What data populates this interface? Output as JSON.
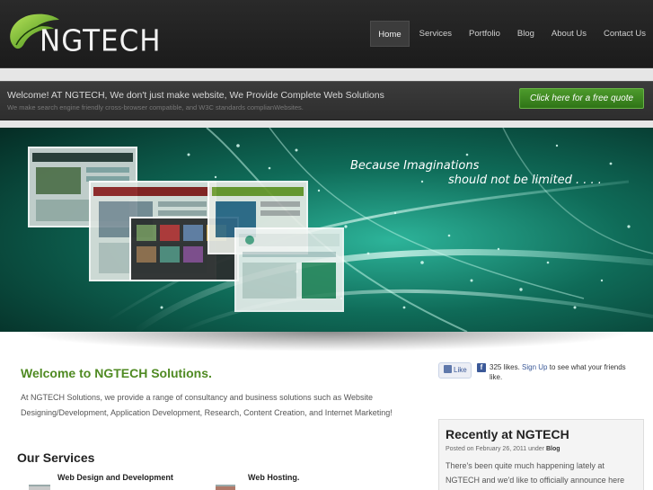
{
  "header": {
    "logo_text": "NGTECH",
    "nav": [
      {
        "label": "Home",
        "active": true
      },
      {
        "label": "Services",
        "active": false
      },
      {
        "label": "Portfolio",
        "active": false
      },
      {
        "label": "Blog",
        "active": false
      },
      {
        "label": "About Us",
        "active": false
      },
      {
        "label": "Contact Us",
        "active": false
      }
    ]
  },
  "welcome_bar": {
    "title": "Welcome! AT NGTECH, We don't just make website, We Provide Complete Web Solutions",
    "subtitle": "We make search engine friendly cross-browser compatible, and W3C standards complianWebsites.",
    "quote_button": "Click here for a free quote"
  },
  "hero": {
    "tagline_line1": "Because  Imaginations",
    "tagline_line2": "should not be limited . . . ."
  },
  "main": {
    "welcome_heading": "Welcome to NGTECH Solutions.",
    "intro": "At NGTECH Solutions, we provide a range of consultancy and business solutions such as Website Designing/Development, Application Development, Research, Content Creation, and Internet Marketing!",
    "services_heading": "Our Services",
    "services": [
      {
        "title": "Web Design and Development"
      },
      {
        "title": "Web Hosting."
      }
    ]
  },
  "facebook": {
    "like_label": "Like",
    "likes_text": "325 likes.",
    "signup_label": "Sign Up",
    "rest_text": "to see what your friends like."
  },
  "recent": {
    "title": "Recently at NGTECH",
    "meta_prefix": "Posted on February 26, 2011 under",
    "meta_category": "Blog",
    "text": "There's been quite much happening lately at NGTECH and we'd like to officially announce here"
  },
  "colors": {
    "header_bg": "#1f1f1f",
    "accent_green": "#4f8a22",
    "quote_button": "#3f8722",
    "hero_teal": "#0f6b55"
  }
}
